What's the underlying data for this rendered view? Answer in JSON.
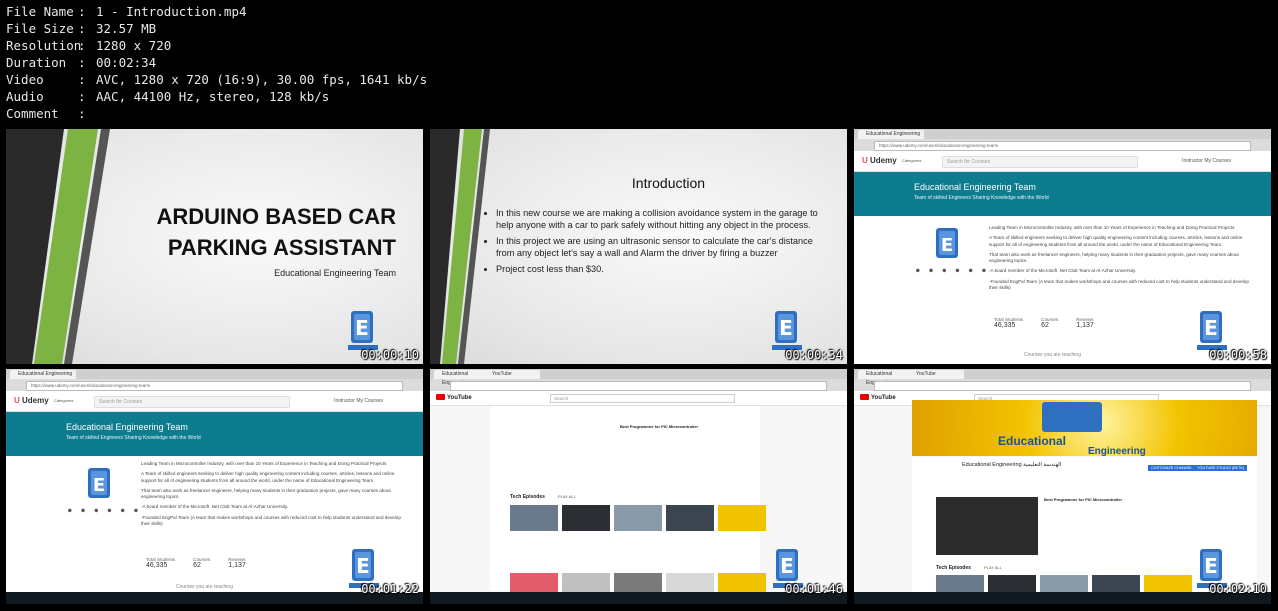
{
  "meta": [
    {
      "key": "File Name",
      "value": "1 - Introduction.mp4"
    },
    {
      "key": "File Size",
      "value": "32.57 MB"
    },
    {
      "key": "Resolution",
      "value": "1280 x 720"
    },
    {
      "key": "Duration",
      "value": "00:02:34"
    },
    {
      "key": "Video",
      "value": "AVC, 1280 x 720 (16:9), 30.00 fps, 1641 kb/s"
    },
    {
      "key": "Audio",
      "value": "AAC, 44100 Hz, stereo, 128 kb/s"
    },
    {
      "key": "Comment",
      "value": ""
    }
  ],
  "thumbs": {
    "t1": {
      "timestamp": "00:00:10",
      "title_line1": "ARDUINO BASED CAR",
      "title_line2": "PARKING ASSISTANT",
      "subtitle": "Educational Engineering Team"
    },
    "t2": {
      "timestamp": "00:00:34",
      "title": "Introduction",
      "bullets": [
        "In this new course we are making a collision avoidance system in the garage to help anyone with a car to park safely without hitting any object in the process.",
        "In this project we are using an ultrasonic sensor to calculate the car's distance from any object let's say a wall and Alarm the driver by firing a buzzer",
        "Project cost less than $30."
      ]
    },
    "t3": {
      "timestamp": "00:00:58",
      "tab": "Educational Engineering",
      "url": "https://www.udemy.com/user/educational-engineering-team/",
      "brand": "Udemy",
      "categories": "Categories",
      "search_placeholder": "Search for Courses",
      "links": "Instructor    My Courses",
      "team_name": "Educational Engineering Team",
      "team_tagline": "Team of skilled Engineers Sharing Knowledge with the World",
      "bio": [
        "Leading Team in Microcontroller Industry, with over than 10 Years of Experience in Teaching and Doing Practical Projects",
        "A Team of skilled engineers seeking to deliver high quality engineering content including courses, articles, lessons and online support for all of engineering students from all around the world, under the name of Educational Engineering Team.",
        "That team also work as freelancer engineers, helping many students in their graduation projects, gave many courses about engineering topics.",
        "-A board member of the Microsoft .Net Club Team at Al-Azhar University.",
        "-Founded EngPal Team (A team that makes workshops and courses with reduced cost to help students understand and develop their skills)"
      ],
      "stats": [
        {
          "label": "Total Students",
          "value": "46,335"
        },
        {
          "label": "Courses",
          "value": "62"
        },
        {
          "label": "Reviews",
          "value": "1,137"
        }
      ],
      "courses_teaching": "Courses you are teaching"
    },
    "t4": {
      "timestamp": "00:01:22"
    },
    "t5": {
      "timestamp": "00:01:46",
      "yt_brand": "YouTube",
      "search": "Search",
      "video_title": "Best Programmer for PIC Microcontroller",
      "section": "Tech Episodes",
      "play_all": "PLAY ALL"
    },
    "t6": {
      "timestamp": "00:02:10",
      "banner_text_1": "Educational",
      "banner_text_2": "Engineering",
      "channel_name": "Educational Engineering الهندسة التعليمية",
      "customize": "CUSTOMIZE CHANNEL",
      "studio": "YOUTUBE STUDIO (BETA)"
    }
  },
  "colors": {
    "teal": "#0e7c8f",
    "green_stripe": "#7cb342",
    "dark_stripe": "#3a3a3a",
    "logo_blue": "#2e6fc0",
    "udemy_red": "#ec5252"
  }
}
